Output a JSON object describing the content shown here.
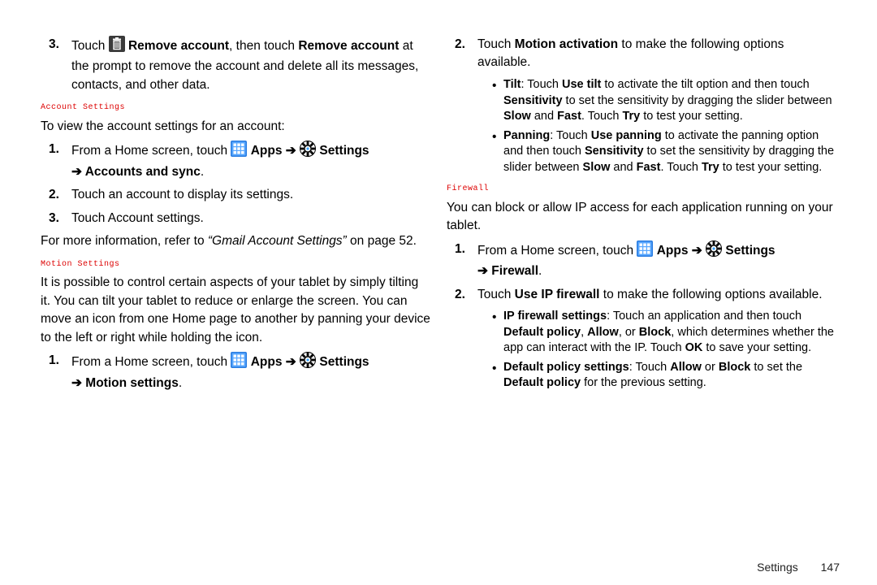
{
  "footer": {
    "section": "Settings",
    "page": "147"
  },
  "left": {
    "item3_a": "Touch ",
    "item3_b": "Remove account",
    "item3_c": ", then touch ",
    "item3_d": "Remove account",
    "item3_e": " at the prompt to remove the account and delete all its messages, contacts, and other data.",
    "acct_label": "Account Settings",
    "acct_intro": "To view the account settings for an account:",
    "a1_a": "From a Home screen, touch ",
    "apps": "Apps",
    "arrow": " ➔ ",
    "settings": "Settings",
    "a1_end": "Accounts and sync",
    "a2": "Touch an account to display its settings.",
    "a3": "Touch Account settings.",
    "ref_a": "For more information, refer to ",
    "ref_b": "“Gmail Account Settings”",
    "ref_c": "  on page 52.",
    "motion_label": "Motion Settings",
    "motion_para": "It is possible to control certain aspects of your tablet by simply tilting it. You can tilt your tablet to reduce or enlarge the screen. You can move an icon from one Home page to another by panning your device to the left or right while holding the icon.",
    "m1_a": "From a Home screen, touch ",
    "m1_end": "Motion settings"
  },
  "right": {
    "m2_a": "Touch ",
    "m2_b": "Motion activation",
    "m2_c": " to make the following options available.",
    "tilt_a": "Tilt",
    "tilt_b": ": Touch ",
    "tilt_c": "Use tilt",
    "tilt_d": " to activate the tilt option and then touch ",
    "tilt_e": "Sensitivity",
    "tilt_f": " to set the sensitivity by dragging the slider between ",
    "tilt_g": "Slow",
    "tilt_h": " and ",
    "tilt_i": "Fast",
    "tilt_j": ". Touch ",
    "tilt_k": "Try",
    "tilt_l": " to test your setting.",
    "pan_a": "Panning",
    "pan_b": ": Touch ",
    "pan_c": "Use panning",
    "pan_d": " to activate the panning option and then touch ",
    "pan_e": "Sensitivity",
    "pan_f": " to set the sensitivity by dragging the slider between ",
    "pan_g": "Slow",
    "pan_h": " and ",
    "pan_i": "Fast",
    "pan_j": ". Touch ",
    "pan_k": "Try",
    "pan_l": " to test your setting.",
    "fw_label": "Firewall",
    "fw_para": "You can block or allow IP access for each application running on your tablet.",
    "f1_a": "From a Home screen, touch ",
    "f1_end": "Firewall",
    "f2_a": "Touch ",
    "f2_b": "Use IP firewall",
    "f2_c": " to make the following options available.",
    "fb1_a": "IP firewall settings",
    "fb1_b": ": Touch an application and then touch ",
    "fb1_c": "Default policy",
    "fb1_d": ", ",
    "fb1_e": "Allow",
    "fb1_f": ", or ",
    "fb1_g": "Block",
    "fb1_h": ", which determines whether the app can interact with the IP. Touch ",
    "fb1_i": "OK",
    "fb1_j": " to save your setting.",
    "fb2_a": "Default policy settings",
    "fb2_b": ": Touch ",
    "fb2_c": "Allow",
    "fb2_d": " or ",
    "fb2_e": "Block",
    "fb2_f": " to set the ",
    "fb2_g": "Default policy",
    "fb2_h": " for the previous setting."
  },
  "nums": {
    "n1": "1.",
    "n2": "2.",
    "n3": "3."
  }
}
